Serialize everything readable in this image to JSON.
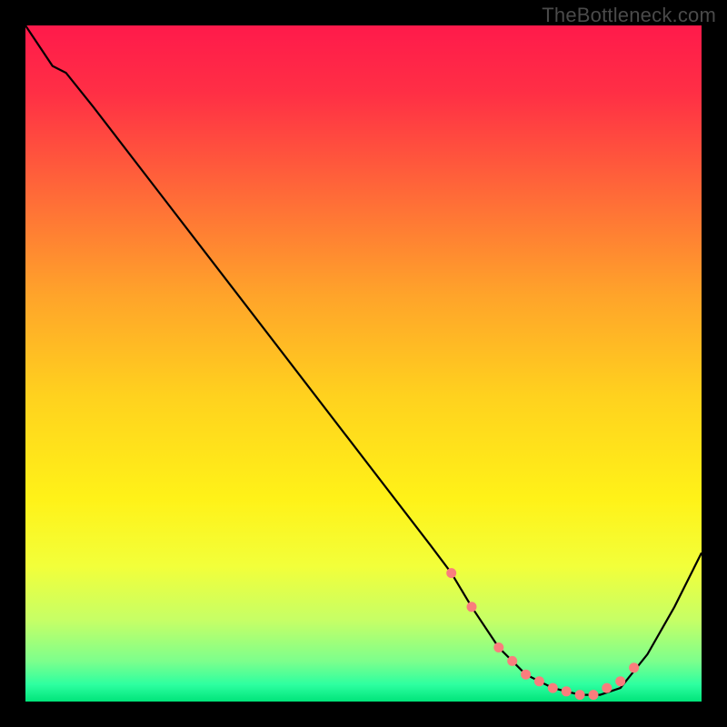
{
  "watermark": "TheBottleneck.com",
  "chart_data": {
    "type": "line",
    "title": "",
    "xlabel": "",
    "ylabel": "",
    "xlim": [
      0,
      100
    ],
    "ylim": [
      0,
      100
    ],
    "series": [
      {
        "name": "curve",
        "x": [
          0,
          4,
          6,
          10,
          20,
          30,
          40,
          50,
          60,
          63,
          66,
          70,
          74,
          78,
          82,
          85,
          88,
          92,
          96,
          100
        ],
        "y": [
          100,
          94,
          93,
          88,
          75,
          62,
          49,
          36,
          23,
          19,
          14,
          8,
          4,
          2,
          1,
          1,
          2,
          7,
          14,
          22
        ]
      }
    ],
    "markers": {
      "name": "dots",
      "x": [
        63,
        66,
        70,
        72,
        74,
        76,
        78,
        80,
        82,
        84,
        86,
        88,
        90
      ],
      "y": [
        19,
        14,
        8,
        6,
        4,
        3,
        2,
        1.5,
        1,
        1,
        2,
        3,
        5
      ]
    },
    "gradient_stops": [
      {
        "offset": 0.0,
        "color": "#ff1a4b"
      },
      {
        "offset": 0.1,
        "color": "#ff2f45"
      },
      {
        "offset": 0.25,
        "color": "#ff6a38"
      },
      {
        "offset": 0.4,
        "color": "#ffa42a"
      },
      {
        "offset": 0.55,
        "color": "#ffd21e"
      },
      {
        "offset": 0.7,
        "color": "#fff218"
      },
      {
        "offset": 0.8,
        "color": "#f2ff3a"
      },
      {
        "offset": 0.88,
        "color": "#c6ff66"
      },
      {
        "offset": 0.94,
        "color": "#7dff8c"
      },
      {
        "offset": 0.975,
        "color": "#2dffa0"
      },
      {
        "offset": 1.0,
        "color": "#00e47a"
      }
    ],
    "marker_color": "#f97d7d",
    "curve_color": "#000000"
  }
}
